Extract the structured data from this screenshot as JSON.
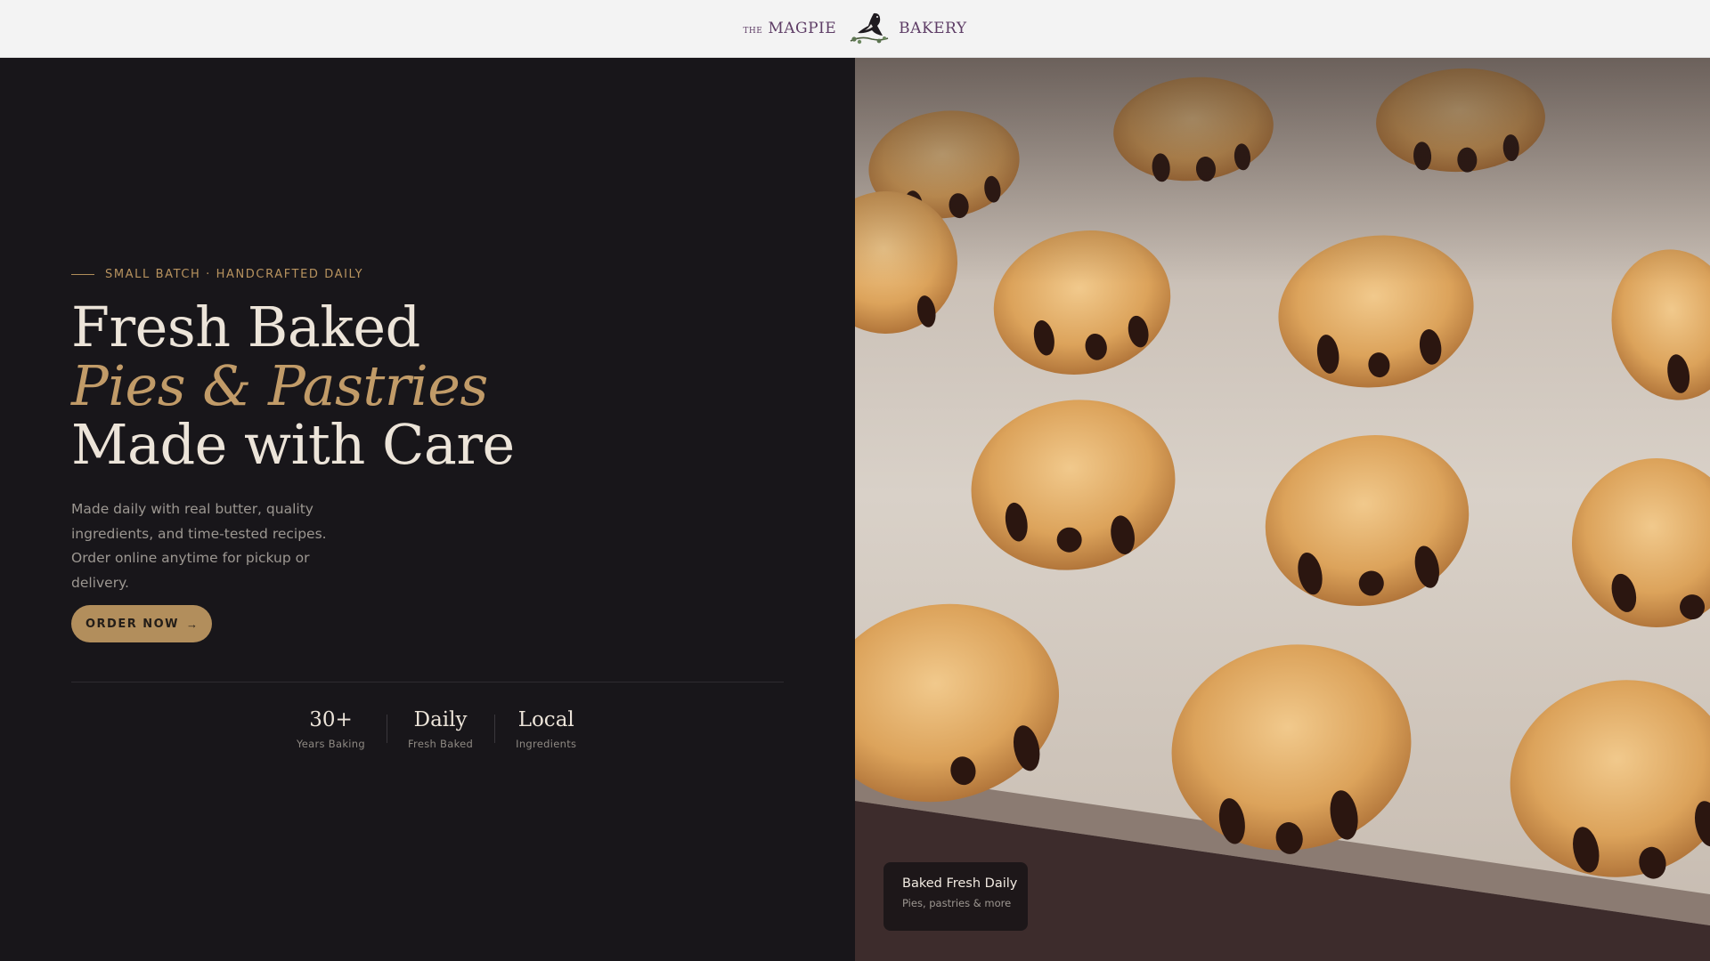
{
  "header": {
    "logo": {
      "the": "THE",
      "word1": "MAGPIE",
      "word2": "BAKERY",
      "icon": "magpie-bird-icon"
    }
  },
  "hero": {
    "eyebrow": "SMALL BATCH · HANDCRAFTED DAILY",
    "headline": {
      "line1": "Fresh Baked",
      "line2": "Pies & Pastries",
      "line3": "Made with Care"
    },
    "description": "Made daily with real butter, quality ingredients, and time-tested recipes. Order online anytime for pickup or delivery.",
    "cta": {
      "label": "ORDER NOW",
      "icon": "arrow-right-icon",
      "arrow": "→"
    },
    "stats": [
      {
        "value": "30+",
        "label": "Years Baking"
      },
      {
        "value": "Daily",
        "label": "Fresh Baked"
      },
      {
        "value": "Local",
        "label": "Ingredients"
      }
    ]
  },
  "image_panel": {
    "image": "pain-au-chocolat-tray-photo",
    "badge": {
      "title": "Baked Fresh Daily",
      "subtitle": "Pies, pastries & more"
    }
  },
  "colors": {
    "header_bg": "#f3f3f3",
    "hero_bg": "#18161a",
    "accent": "#b28e5c",
    "headline": "#ece4d9",
    "logo": "#5e3d66"
  }
}
